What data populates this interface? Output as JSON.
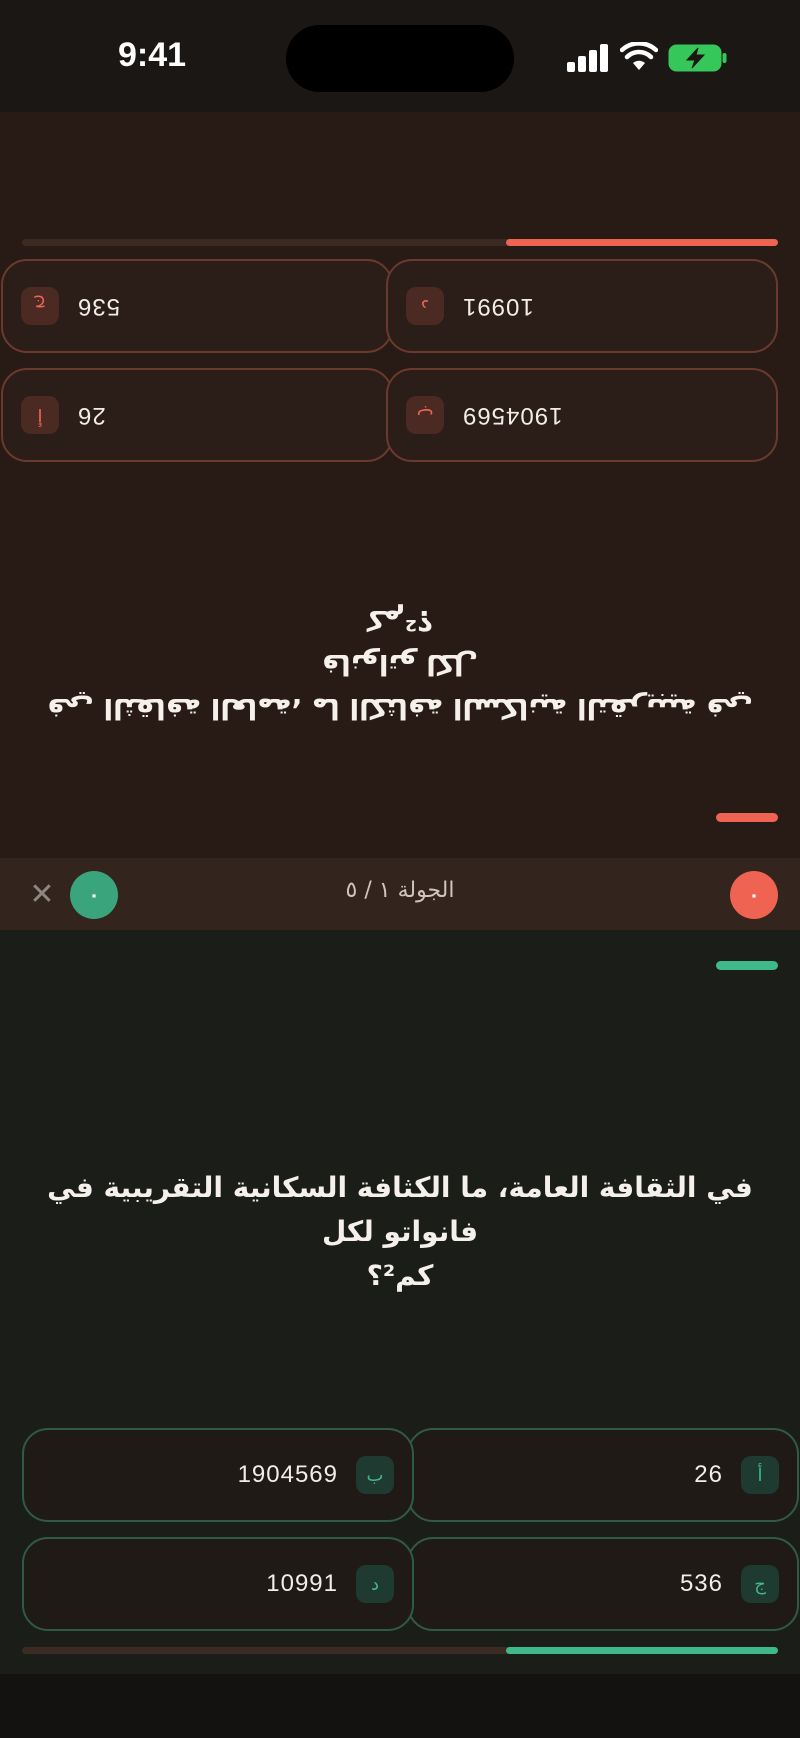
{
  "status_bar": {
    "time": "9:41"
  },
  "opponent": {
    "question_line1": "في الثقافة العامة، ما الكثافة السكانية التقريبية في فانواتو لكل",
    "question_line2": "كم²؟",
    "progress": 0.36,
    "answers": [
      {
        "letter": "أ",
        "value": "26"
      },
      {
        "letter": "ب",
        "value": "1904569"
      },
      {
        "letter": "ج",
        "value": "536"
      },
      {
        "letter": "د",
        "value": "10991"
      }
    ],
    "accent_color": "#ee6352"
  },
  "mid_bar": {
    "round_label": "الجولة ١ / ٥",
    "opponent_score": "٠",
    "player_score": "٠",
    "close_icon": "close-icon",
    "close_glyph": "✕"
  },
  "player": {
    "question_line1": "في الثقافة العامة، ما الكثافة السكانية التقريبية في فانواتو لكل",
    "question_line2": "كم²؟",
    "progress": 0.36,
    "answers": [
      {
        "letter": "أ",
        "value": "26"
      },
      {
        "letter": "ب",
        "value": "1904569"
      },
      {
        "letter": "ج",
        "value": "536"
      },
      {
        "letter": "د",
        "value": "10991"
      }
    ],
    "accent_color": "#3fb88a"
  },
  "colors": {
    "opponent_accent": "#ee6352",
    "player_accent": "#3fb88a",
    "top_bg": "#281b16",
    "bottom_bg": "#1b1d18"
  }
}
